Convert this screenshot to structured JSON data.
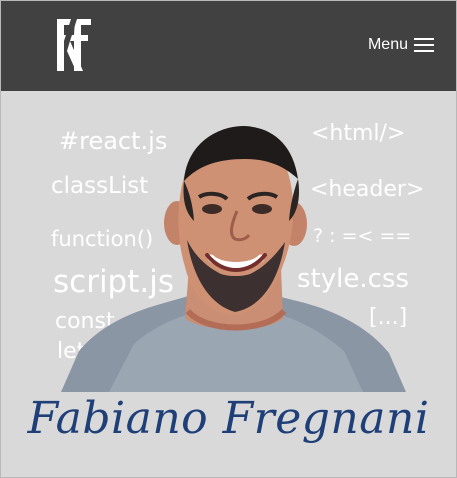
{
  "header": {
    "menu_label": "Menu",
    "logo_icon": "fa-monogram-icon",
    "menu_icon": "hamburger-menu-icon",
    "background_color": "#414141"
  },
  "hero": {
    "background_color": "#d9d9d9",
    "code_words": {
      "react": "#react.js",
      "classlist": "classList",
      "function": "function()",
      "script": "script.js",
      "const": "const",
      "let": "let",
      "html": "<html/>",
      "header": "<header>",
      "operators": "? : =< ==",
      "style": "style.css",
      "ellipsis": "[...]"
    },
    "signature": "Fabiano Fregnani",
    "signature_color": "#1f3f78"
  }
}
